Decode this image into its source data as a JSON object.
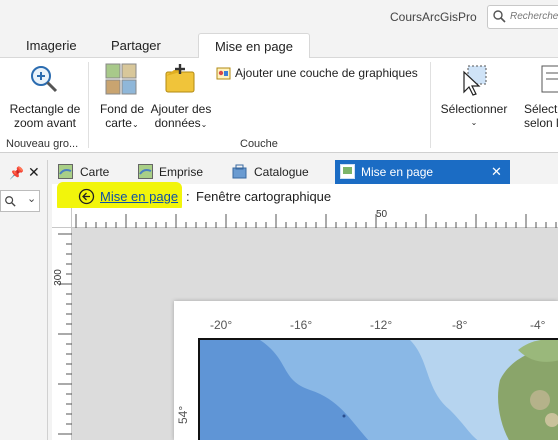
{
  "titlebar": {
    "project": "CoursArcGisPro",
    "search_placeholder": "Rechercher"
  },
  "ribbon_tabs": [
    "Imagerie",
    "Partager",
    "Mise en page"
  ],
  "ribbon": {
    "zoom_rect_line1": "Rectangle de",
    "zoom_rect_line2": "zoom avant",
    "group_nav": "Nouveau gro...",
    "basemap_line1": "Fond de",
    "basemap_line2": "carte",
    "add_data_line1": "Ajouter des",
    "add_data_line2": "données",
    "add_graphics_layer": "Ajouter une couche de graphiques",
    "group_layer": "Couche",
    "select": "Sélectionner",
    "select_by_line1": "Sélecti",
    "select_by_line2": "selon les"
  },
  "doc_tabs": {
    "carte": "Carte",
    "emprise": "Emprise",
    "catalogue": "Catalogue",
    "mise_en_page": "Mise en page"
  },
  "breadcrumb": {
    "link": "Mise en page",
    "separator": ":",
    "current": "Fenêtre cartographique"
  },
  "rulers": {
    "h_label": "50",
    "v_label": "300"
  },
  "map": {
    "lon_labels": [
      "-20°",
      "-16°",
      "-12°",
      "-8°",
      "-4°"
    ],
    "lat_label": "54°"
  },
  "colors": {
    "active_tab": "#1b6cc4",
    "highlight": "#f2f50b",
    "link": "#0d4fa8",
    "ocean": "#6b9fd8",
    "land": "#8aa56a"
  }
}
